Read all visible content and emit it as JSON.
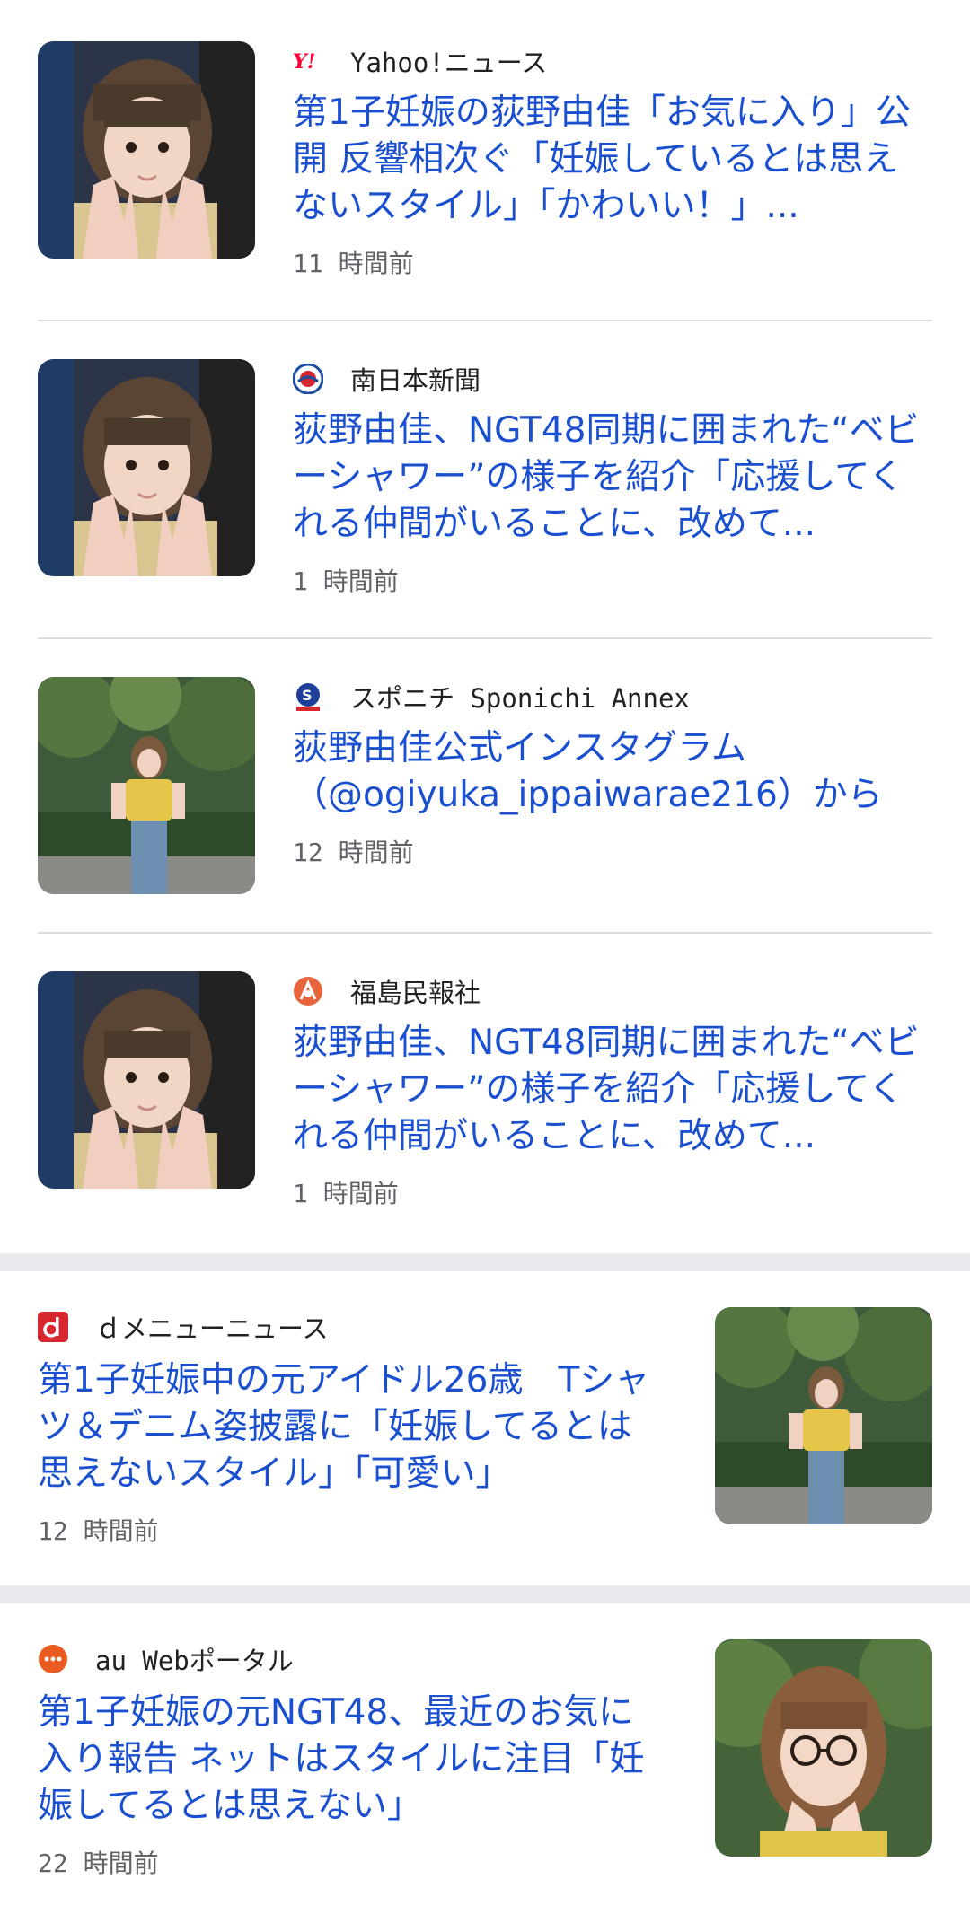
{
  "cluster": {
    "items": [
      {
        "source": "Yahoo!ニュース",
        "logo_icon": "yahoo-news-logo",
        "title": "第1子妊娠の荻野由佳「お気に入り」公開 反響相次ぐ「妊娠しているとは思えないスタイル」「かわいい！」...",
        "time": "11 時間前",
        "thumb": "portrait-hands"
      },
      {
        "source": "南日本新聞",
        "logo_icon": "minaminippon-logo",
        "title": "荻野由佳、NGT48同期に囲まれた“ベビーシャワー”の様子を紹介「応援してくれる仲間がいることに、改めて...",
        "time": "1 時間前",
        "thumb": "portrait-hands"
      },
      {
        "source": "スポニチ Sponichi Annex",
        "logo_icon": "sponichi-logo",
        "title": "荻野由佳公式インスタグラム（@ogiyuka_ippaiwarae216）から",
        "time": "12 時間前",
        "thumb": "outdoor-standing"
      },
      {
        "source": "福島民報社",
        "logo_icon": "minpo-logo",
        "title": "荻野由佳、NGT48同期に囲まれた“ベビーシャワー”の様子を紹介「応援してくれる仲間がいることに、改めて...",
        "time": "1 時間前",
        "thumb": "portrait-hands"
      }
    ]
  },
  "cards": [
    {
      "source": "ｄメニューニュース",
      "logo_icon": "d-menu-logo",
      "title": "第1子妊娠中の元アイドル26歳　Tシャツ＆デニム姿披露に「妊娠してるとは思えないスタイル」「可愛い」",
      "time": "12 時間前",
      "thumb": "outdoor-standing"
    },
    {
      "source": "au Webポータル",
      "logo_icon": "au-web-logo",
      "title": "第1子妊娠の元NGT48、最近のお気に入り報告 ネットはスタイルに注目「妊娠してるとは思えない」",
      "time": "22 時間前",
      "thumb": "glasses-portrait"
    }
  ],
  "colors": {
    "title": "#1a4fd0",
    "meta": "#5f6368",
    "divider": "#dadce0",
    "section_gap": "#e8eaed"
  }
}
